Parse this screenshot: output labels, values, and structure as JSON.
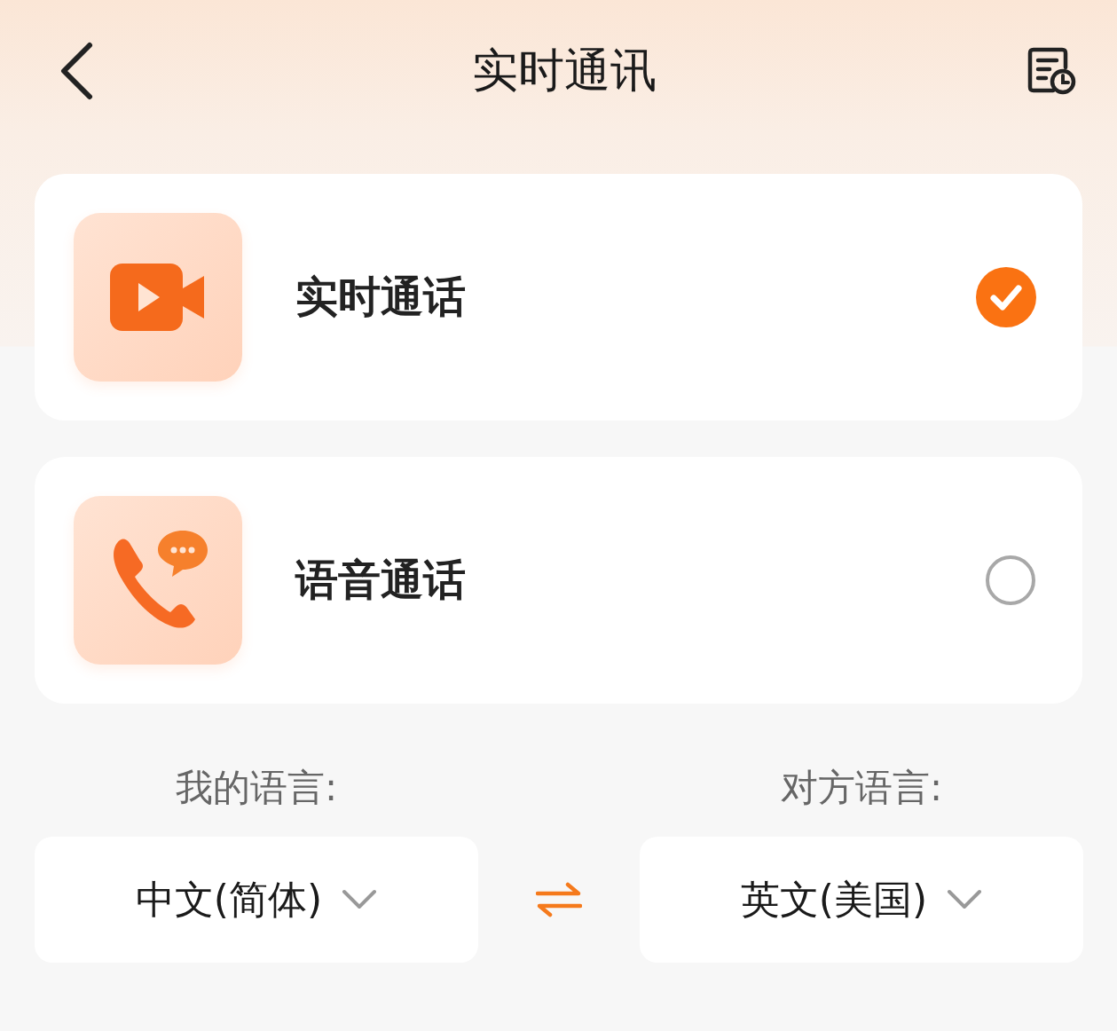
{
  "header": {
    "title": "实时通讯"
  },
  "modes": [
    {
      "label": "实时通话",
      "kind": "video",
      "selected": true
    },
    {
      "label": "语音通话",
      "kind": "voice",
      "selected": false
    }
  ],
  "languages": [
    {
      "label": "我的语言:",
      "value": "中文(简体)"
    },
    {
      "label": "对方语言:",
      "value": "英文(美国)"
    }
  ]
}
